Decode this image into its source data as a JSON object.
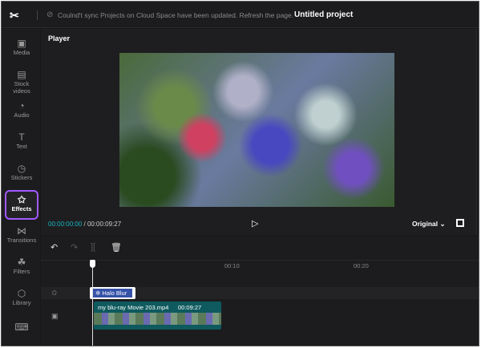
{
  "topbar": {
    "logo": "✂",
    "sync_message": "Coulnd't sync Projects on Cloud Space have been updated. Refresh the page.",
    "project_title": "Untitled project"
  },
  "sidebar": {
    "items": [
      {
        "label": "Media",
        "icon": "▣"
      },
      {
        "label": "Stock videos",
        "icon": "▤"
      },
      {
        "label": "Audio",
        "icon": "◔"
      },
      {
        "label": "Text",
        "icon": "T"
      },
      {
        "label": "Stickers",
        "icon": "◷"
      },
      {
        "label": "Effects",
        "icon": "✩"
      },
      {
        "label": "Transitions",
        "icon": "⋈"
      },
      {
        "label": "Filters",
        "icon": "☘"
      },
      {
        "label": "Library",
        "icon": "⬡"
      }
    ],
    "keyboard_icon": "⌨"
  },
  "player": {
    "label": "Player",
    "current_time": "00:00:00:00",
    "total_time": "00:00:09:27",
    "ratio": "Original ⌄"
  },
  "timeline": {
    "ticks": [
      "00:10",
      "00:20"
    ],
    "effect_clip": "✲ Halo Blur",
    "video_clip": {
      "name": "my blu-ray Movie 203.mp4",
      "duration": "00:09:27"
    }
  }
}
